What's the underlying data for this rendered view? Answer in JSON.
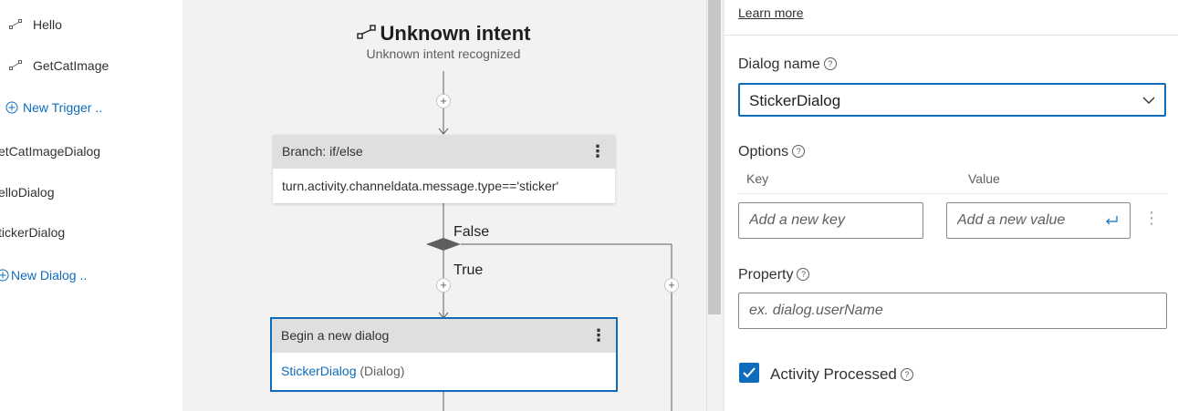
{
  "sidebar": {
    "triggers": [
      "Hello",
      "GetCatImage"
    ],
    "new_trigger": "New Trigger ..",
    "dialogs": [
      "etCatImageDialog",
      "elloDialog",
      "tickerDialog"
    ],
    "new_dialog": "New Dialog .."
  },
  "canvas": {
    "trigger_title": "Unknown intent",
    "trigger_subtitle": "Unknown intent recognized",
    "branch": {
      "title": "Branch: if/else",
      "condition": "turn.activity.channeldata.message.type=='sticker'",
      "false_label": "False",
      "true_label": "True"
    },
    "begin_dialog": {
      "title": "Begin a new dialog",
      "dialog_name": "StickerDialog",
      "dialog_type": "(Dialog)"
    }
  },
  "panel": {
    "learn_more": "Learn more",
    "dialog_name_label": "Dialog name",
    "dialog_name_value": "StickerDialog",
    "options_label": "Options",
    "key_header": "Key",
    "value_header": "Value",
    "key_placeholder": "Add a new key",
    "value_placeholder": "Add a new value",
    "property_label": "Property",
    "property_placeholder": "ex. dialog.userName",
    "activity_processed_label": "Activity Processed",
    "activity_processed_checked": true
  },
  "colors": {
    "accent": "#0f6cbd",
    "canvas_bg": "#f3f2f1",
    "card_header": "#e1dfdd"
  }
}
